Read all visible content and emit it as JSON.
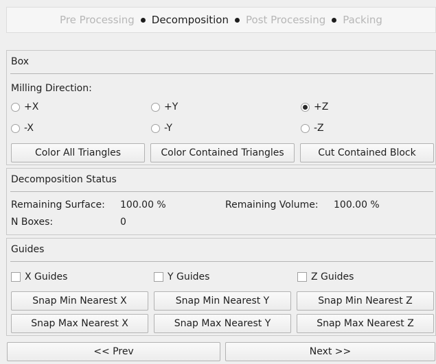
{
  "steps": [
    "Pre Processing",
    "Decomposition",
    "Post Processing",
    "Packing"
  ],
  "active_step": 1,
  "box": {
    "title": "Box",
    "milling_label": "Milling Direction:",
    "radios": [
      "+X",
      "+Y",
      "+Z",
      "-X",
      "-Y",
      "-Z"
    ],
    "selected": "+Z",
    "buttons": [
      "Color All Triangles",
      "Color Contained Triangles",
      "Cut Contained Block"
    ]
  },
  "status": {
    "title": "Decomposition Status",
    "remaining_surface_label": "Remaining Surface:",
    "remaining_surface_value": "100.00 %",
    "remaining_volume_label": "Remaining Volume:",
    "remaining_volume_value": "100.00 %",
    "n_boxes_label": "N Boxes:",
    "n_boxes_value": "0"
  },
  "guides": {
    "title": "Guides",
    "checks": [
      "X Guides",
      "Y Guides",
      "Z Guides"
    ],
    "snap_min": [
      "Snap Min Nearest X",
      "Snap Min Nearest Y",
      "Snap Min Nearest Z"
    ],
    "snap_max": [
      "Snap Max Nearest X",
      "Snap Max Nearest Y",
      "Snap Max Nearest Z"
    ]
  },
  "nav": {
    "prev": "<< Prev",
    "next": "Next >>"
  }
}
